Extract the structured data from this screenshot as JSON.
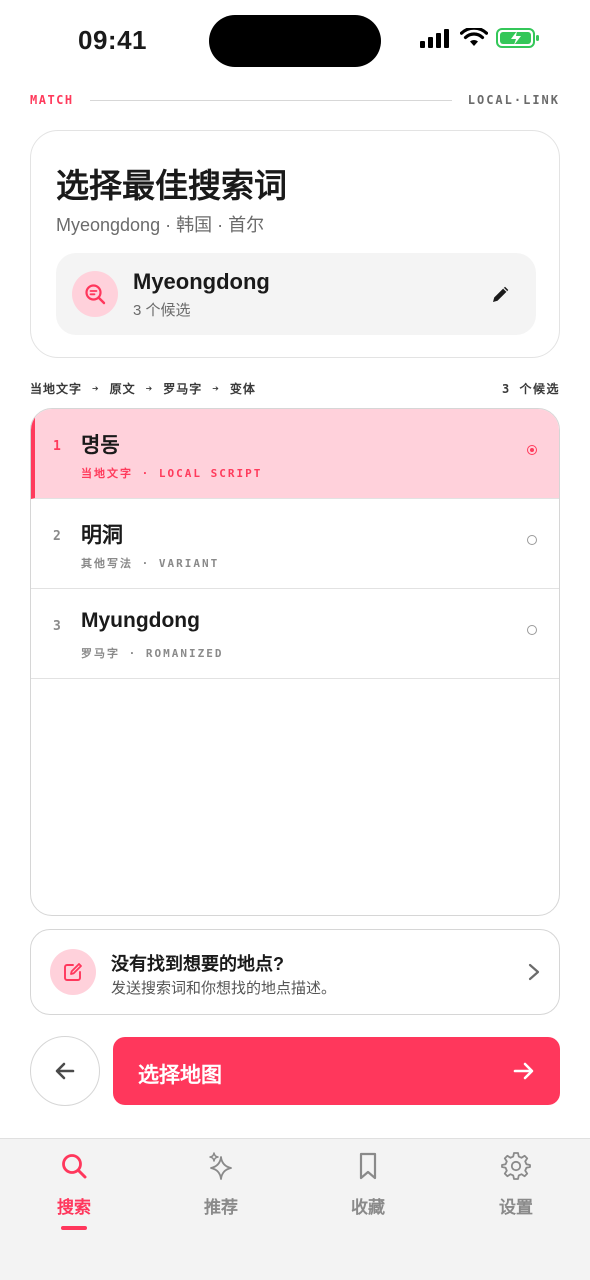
{
  "status_bar": {
    "time": "09:41"
  },
  "brand": {
    "left": "MATCH",
    "right": "LOCAL·LINK"
  },
  "header": {
    "title": "选择最佳搜索词",
    "location": "Myeongdong · 韩国 · 首尔",
    "query": "Myeongdong",
    "candidate_count": "3 个候选"
  },
  "pipeline": {
    "steps": [
      "当地文字",
      "原文",
      "罗马字",
      "变体"
    ],
    "count": "3 个候选"
  },
  "candidates": [
    {
      "index": "1",
      "name": "명동",
      "tag": "当地文字 · LOCAL SCRIPT",
      "selected": true
    },
    {
      "index": "2",
      "name": "明洞",
      "tag": "其他写法 · VARIANT",
      "selected": false
    },
    {
      "index": "3",
      "name": "Myungdong",
      "tag": "罗马字 · ROMANIZED",
      "selected": false
    }
  ],
  "help": {
    "title": "没有找到想要的地点?",
    "subtitle": "发送搜索词和你想找的地点描述。"
  },
  "actions": {
    "primary_label": "选择地图"
  },
  "tabs": [
    {
      "label": "搜索",
      "icon": "search-icon",
      "active": true
    },
    {
      "label": "推荐",
      "icon": "sparkle-icon",
      "active": false
    },
    {
      "label": "收藏",
      "icon": "bookmark-icon",
      "active": false
    },
    {
      "label": "设置",
      "icon": "gear-icon",
      "active": false
    }
  ],
  "colors": {
    "accent": "#ff375c",
    "accent_soft": "#ffd1db"
  }
}
